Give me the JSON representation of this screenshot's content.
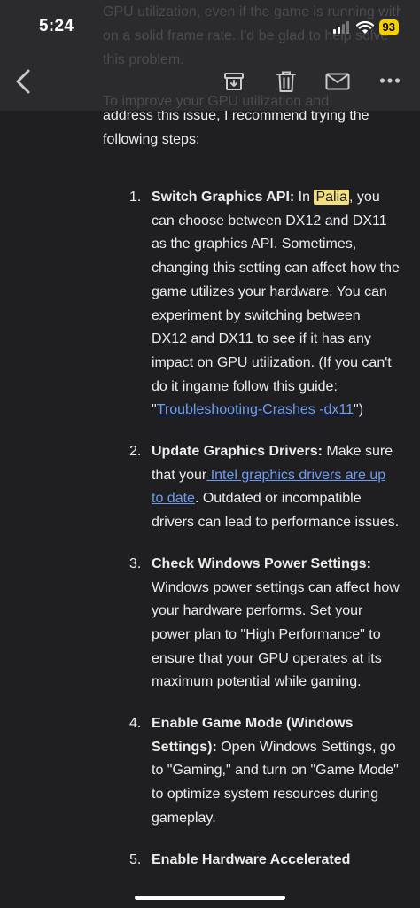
{
  "status": {
    "time": "5:24",
    "battery": "93"
  },
  "toolbar": {
    "back": "back-arrow",
    "icons": [
      "archive-icon",
      "trash-icon",
      "mail-icon",
      "more-icon"
    ]
  },
  "faded": [
    "GPU utilization, even if the game is running with",
    "on a solid frame rate. I'd be glad to help solve",
    "this problem.",
    "To improve your GPU utilization and"
  ],
  "intro": "address this issue, I recommend trying the following steps:",
  "steps": [
    {
      "num": "1.",
      "title": "Switch Graphics API:",
      "pre": " In ",
      "highlight": "Palia",
      "text": ", you can choose between DX12 and DX11 as the graphics API. Sometimes, changing this setting can affect how the game utilizes your hardware. You can experiment by switching between DX12 and DX11 to see if it has any impact on GPU utilization. (If you can't do it ingame follow this guide: \"",
      "link": "Troubleshooting-Crashes -dx11",
      "post": "\")"
    },
    {
      "num": "2.",
      "title": "Update Graphics Drivers:",
      "pre": " Make sure that your",
      "link": " Intel graphics drivers are up to date",
      "post": ". Outdated or incompatible drivers can lead to performance issues."
    },
    {
      "num": "3.",
      "title": "Check Windows Power Settings:",
      "text": " Windows power settings can affect how your hardware performs. Set your power plan to \"High Performance\" to ensure that your GPU operates at its maximum potential while gaming."
    },
    {
      "num": "4.",
      "title": "Enable Game Mode (Windows Settings):",
      "text": " Open Windows Settings, go to \"Gaming,\" and turn on \"Game Mode\" to optimize system resources during gameplay."
    },
    {
      "num": "5.",
      "title": "Enable Hardware Accelerated",
      "text": ""
    }
  ]
}
